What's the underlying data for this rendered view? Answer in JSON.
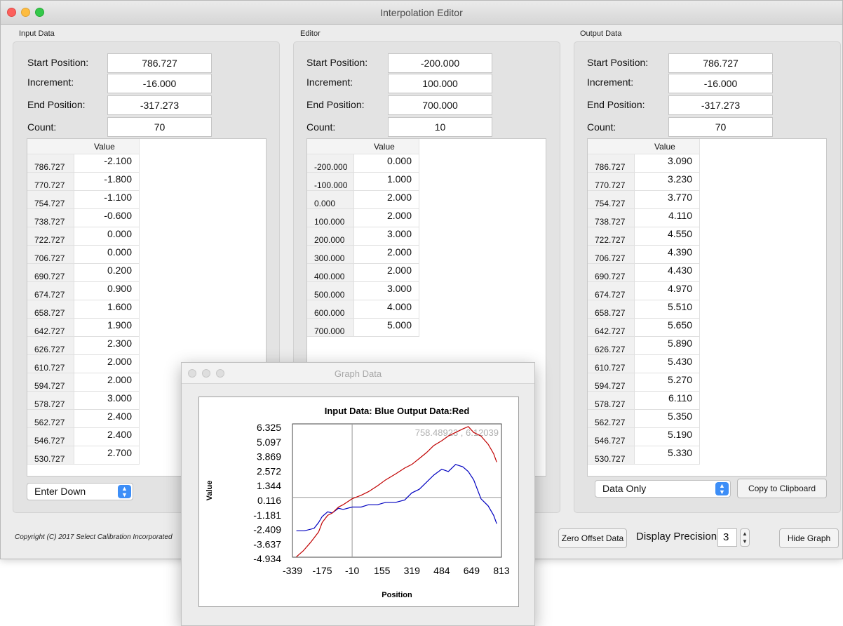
{
  "window": {
    "title": "Interpolation Editor"
  },
  "labels": {
    "start_position": "Start Position:",
    "increment": "Increment:",
    "end_position": "End Position:",
    "count": "Count:",
    "value_header": "Value"
  },
  "input_data": {
    "title": "Input Data",
    "start_position": "786.727",
    "increment": "-16.000",
    "end_position": "-317.273",
    "count": "70",
    "rows": [
      {
        "pos": "786.727",
        "val": "-2.100"
      },
      {
        "pos": "770.727",
        "val": "-1.800"
      },
      {
        "pos": "754.727",
        "val": "-1.100"
      },
      {
        "pos": "738.727",
        "val": "-0.600"
      },
      {
        "pos": "722.727",
        "val": "0.000"
      },
      {
        "pos": "706.727",
        "val": "0.000"
      },
      {
        "pos": "690.727",
        "val": "0.200"
      },
      {
        "pos": "674.727",
        "val": "0.900"
      },
      {
        "pos": "658.727",
        "val": "1.600"
      },
      {
        "pos": "642.727",
        "val": "1.900"
      },
      {
        "pos": "626.727",
        "val": "2.300"
      },
      {
        "pos": "610.727",
        "val": "2.000"
      },
      {
        "pos": "594.727",
        "val": "2.000"
      },
      {
        "pos": "578.727",
        "val": "3.000"
      },
      {
        "pos": "562.727",
        "val": "2.400"
      },
      {
        "pos": "546.727",
        "val": "2.400"
      },
      {
        "pos": "530.727",
        "val": "2.700"
      }
    ],
    "entry_mode": "Enter Down"
  },
  "editor": {
    "title": "Editor",
    "start_position": "-200.000",
    "increment": "100.000",
    "end_position": "700.000",
    "count": "10",
    "rows": [
      {
        "pos": "-200.000",
        "val": "0.000"
      },
      {
        "pos": "-100.000",
        "val": "1.000"
      },
      {
        "pos": "0.000",
        "val": "2.000"
      },
      {
        "pos": "100.000",
        "val": "2.000"
      },
      {
        "pos": "200.000",
        "val": "3.000"
      },
      {
        "pos": "300.000",
        "val": "2.000"
      },
      {
        "pos": "400.000",
        "val": "2.000"
      },
      {
        "pos": "500.000",
        "val": "3.000"
      },
      {
        "pos": "600.000",
        "val": "4.000"
      },
      {
        "pos": "700.000",
        "val": "5.000"
      }
    ]
  },
  "output_data": {
    "title": "Output Data",
    "start_position": "786.727",
    "increment": "-16.000",
    "end_position": "-317.273",
    "count": "70",
    "rows": [
      {
        "pos": "786.727",
        "val": "3.090"
      },
      {
        "pos": "770.727",
        "val": "3.230"
      },
      {
        "pos": "754.727",
        "val": "3.770"
      },
      {
        "pos": "738.727",
        "val": "4.110"
      },
      {
        "pos": "722.727",
        "val": "4.550"
      },
      {
        "pos": "706.727",
        "val": "4.390"
      },
      {
        "pos": "690.727",
        "val": "4.430"
      },
      {
        "pos": "674.727",
        "val": "4.970"
      },
      {
        "pos": "658.727",
        "val": "5.510"
      },
      {
        "pos": "642.727",
        "val": "5.650"
      },
      {
        "pos": "626.727",
        "val": "5.890"
      },
      {
        "pos": "610.727",
        "val": "5.430"
      },
      {
        "pos": "594.727",
        "val": "5.270"
      },
      {
        "pos": "578.727",
        "val": "6.110"
      },
      {
        "pos": "562.727",
        "val": "5.350"
      },
      {
        "pos": "546.727",
        "val": "5.190"
      },
      {
        "pos": "530.727",
        "val": "5.330"
      }
    ],
    "display_mode": "Data Only",
    "copy_button": "Copy to Clipboard"
  },
  "footer": {
    "copyright": "Copyright (C) 2017 Select Calibration Incorporated",
    "zero_offset_button": "Zero Offset Data",
    "precision_label": "Display Precision:",
    "precision_value": "3",
    "hide_graph_button": "Hide Graph"
  },
  "colors": {
    "input_series": "#0000c0",
    "output_series": "#c00000",
    "accent": "#3d8ef7"
  },
  "graph_window": {
    "title": "Graph Data"
  },
  "chart_data": {
    "type": "line",
    "title": "Input Data: Blue  Output Data:Red",
    "xlabel": "Position",
    "ylabel": "Value",
    "cursor_readout": "758.48923 , 6.12039",
    "x_ticks": [
      "-339",
      "-175",
      "-10",
      "155",
      "319",
      "484",
      "649",
      "813"
    ],
    "y_ticks": [
      "6.325",
      "5.097",
      "3.869",
      "2.572",
      "1.344",
      "0.116",
      "-1.181",
      "-2.409",
      "-3.637",
      "-4.934"
    ],
    "xlim": [
      -339,
      813
    ],
    "ylim": [
      -4.934,
      6.325
    ],
    "cursor": {
      "x": -10,
      "y": 0.116
    },
    "series": [
      {
        "name": "Input Data",
        "color": "#0000c0",
        "x": [
          -317.273,
          -273,
          -220,
          -195,
          -175,
          -145,
          -120,
          -85,
          -60,
          -10,
          40,
          80,
          130,
          175,
          230,
          280,
          319,
          360,
          400,
          440,
          484,
          520,
          560,
          600,
          630,
          660,
          700,
          740,
          770,
          786.727
        ],
        "y": [
          -2.7,
          -2.7,
          -2.5,
          -2.0,
          -1.5,
          -1.1,
          -1.2,
          -0.8,
          -0.9,
          -0.7,
          -0.7,
          -0.5,
          -0.5,
          -0.3,
          -0.3,
          -0.1,
          0.5,
          0.8,
          1.4,
          2.0,
          2.5,
          2.3,
          2.9,
          2.7,
          2.3,
          1.6,
          0.0,
          -0.6,
          -1.4,
          -2.1
        ]
      },
      {
        "name": "Output Data",
        "color": "#c00000",
        "x": [
          -317.273,
          -280,
          -240,
          -195,
          -175,
          -145,
          -120,
          -85,
          -60,
          -10,
          40,
          80,
          130,
          175,
          230,
          280,
          319,
          360,
          400,
          440,
          484,
          520,
          560,
          600,
          630,
          660,
          700,
          740,
          770,
          786.727
        ],
        "y": [
          -4.9,
          -4.4,
          -3.7,
          -2.8,
          -2.0,
          -1.4,
          -1.2,
          -0.7,
          -0.5,
          0.0,
          0.3,
          0.6,
          1.1,
          1.6,
          2.1,
          2.6,
          2.9,
          3.4,
          3.9,
          4.5,
          4.9,
          5.3,
          5.6,
          5.9,
          6.1,
          5.6,
          5.3,
          4.6,
          3.8,
          3.1
        ]
      }
    ]
  }
}
